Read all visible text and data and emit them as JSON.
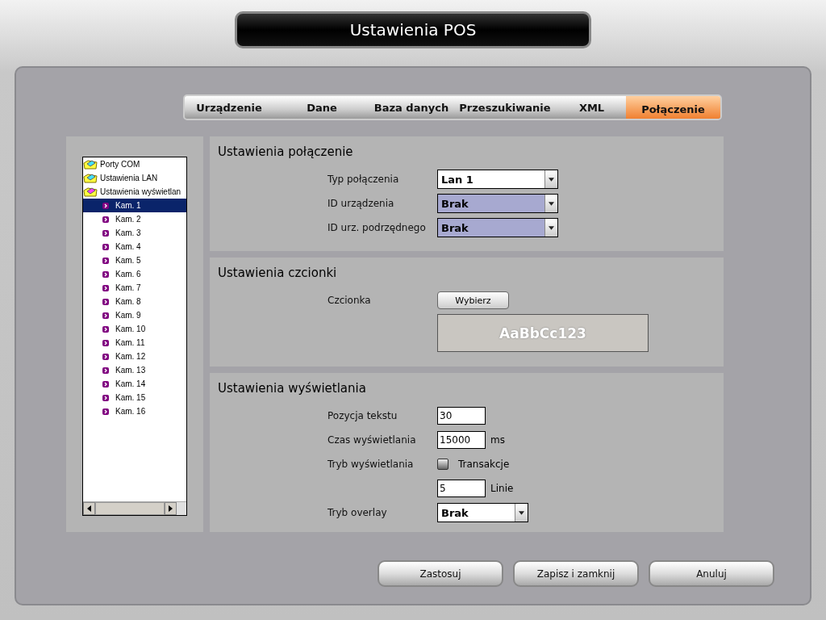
{
  "window": {
    "title": "Ustawienia POS"
  },
  "tabs": [
    {
      "label": "Urządzenie",
      "selected": false
    },
    {
      "label": "Dane",
      "selected": false
    },
    {
      "label": "Baza danych",
      "selected": false
    },
    {
      "label": "Przeszukiwanie",
      "selected": false
    },
    {
      "label": "XML",
      "selected": false
    },
    {
      "label": "Połączenie",
      "selected": true
    }
  ],
  "tree": [
    {
      "label": "Porty COM",
      "expanded": false,
      "selected": false
    },
    {
      "label": "Ustawienia LAN",
      "expanded": false,
      "selected": false
    },
    {
      "label": "Ustawienia wyświetlan",
      "expanded": true,
      "selected": false,
      "children": [
        {
          "label": "Kam. 1",
          "selected": true
        },
        {
          "label": "Kam. 2",
          "selected": false
        },
        {
          "label": "Kam. 3",
          "selected": false
        },
        {
          "label": "Kam. 4",
          "selected": false
        },
        {
          "label": "Kam. 5",
          "selected": false
        },
        {
          "label": "Kam. 6",
          "selected": false
        },
        {
          "label": "Kam. 7",
          "selected": false
        },
        {
          "label": "Kam. 8",
          "selected": false
        },
        {
          "label": "Kam. 9",
          "selected": false
        },
        {
          "label": "Kam. 10",
          "selected": false
        },
        {
          "label": "Kam. 11",
          "selected": false
        },
        {
          "label": "Kam. 12",
          "selected": false
        },
        {
          "label": "Kam. 13",
          "selected": false
        },
        {
          "label": "Kam. 14",
          "selected": false
        },
        {
          "label": "Kam. 15",
          "selected": false
        },
        {
          "label": "Kam. 16",
          "selected": false
        }
      ]
    }
  ],
  "sections": [
    {
      "title": "Ustawienia połączenie",
      "rows": [
        {
          "kind": "select",
          "label": "Typ połączenia",
          "value": "Lan 1",
          "disabled": false
        },
        {
          "kind": "select",
          "label": "ID urządzenia",
          "value": "Brak",
          "disabled": true
        },
        {
          "kind": "select",
          "label": "ID urz. podrzędnego",
          "value": "Brak",
          "disabled": true
        }
      ]
    },
    {
      "title": "Ustawienia czcionki",
      "rows": [
        {
          "kind": "button",
          "label": "Czcionka",
          "value": "Wybierz"
        },
        {
          "kind": "preview",
          "value": "AaBbCc123"
        }
      ]
    },
    {
      "title": "Ustawienia wyświetlania",
      "rows": [
        {
          "kind": "text",
          "label": "Pozycja tekstu",
          "value": "30"
        },
        {
          "kind": "text",
          "label": "Czas wyświetlania",
          "value": "15000",
          "unit": "ms"
        },
        {
          "kind": "checkbox",
          "label": "Tryb wyświetlania",
          "value": "Transakcje",
          "checked": false
        },
        {
          "kind": "text",
          "value": "5",
          "unit": "Linie"
        },
        {
          "kind": "select",
          "label": "Tryb overlay",
          "value": "Brak",
          "disabled": false
        }
      ]
    }
  ],
  "buttons": [
    "Zastosuj",
    "Zapisz i zamknij",
    "Anuluj"
  ]
}
